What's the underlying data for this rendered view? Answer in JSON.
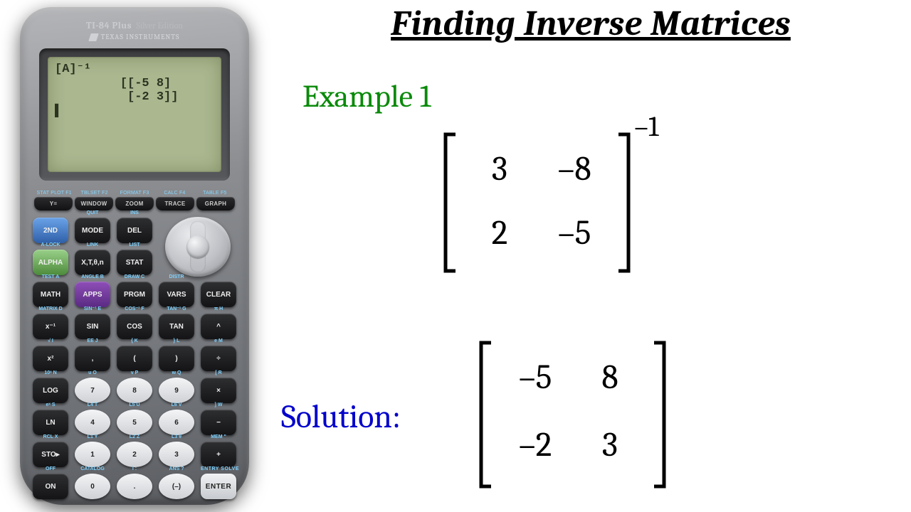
{
  "title": "Finding Inverse Matrices",
  "example_label": "Example 1",
  "solution_label": "Solution:",
  "matrix1": {
    "a11": "3",
    "a12": "–8",
    "a21": "2",
    "a22": "–5",
    "exp": "–1"
  },
  "matrix2": {
    "a11": "–5",
    "a12": "8",
    "a21": "–2",
    "a22": "3"
  },
  "calc": {
    "model": "TI-84 Plus",
    "edition": "Silver Edition",
    "brand": "TEXAS INSTRUMENTS",
    "screen": "[A]⁻¹\n         [[-5 8]\n          [-2 3]]\n▌",
    "frow_labels": [
      "STAT PLOT F1",
      "TBLSET F2",
      "FORMAT F3",
      "CALC F4",
      "TABLE F5"
    ],
    "frow_btns": [
      "Y=",
      "WINDOW",
      "ZOOM",
      "TRACE",
      "GRAPH"
    ],
    "rows": [
      [
        {
          "t": "2ND",
          "cls": "blue",
          "sup": ""
        },
        {
          "t": "MODE",
          "sup": "QUIT"
        },
        {
          "t": "DEL",
          "sup": "INS"
        },
        {
          "dpad": true
        }
      ],
      [
        {
          "t": "ALPHA",
          "cls": "green",
          "sup": "A-LOCK"
        },
        {
          "t": "X,T,θ,n",
          "sup": "LINK"
        },
        {
          "t": "STAT",
          "sup": "LIST"
        }
      ],
      [
        {
          "t": "MATH",
          "sup": "TEST A"
        },
        {
          "t": "APPS",
          "cls": "purple",
          "sup": "ANGLE B"
        },
        {
          "t": "PRGM",
          "sup": "DRAW C"
        },
        {
          "t": "VARS",
          "sup": "DISTR"
        },
        {
          "t": "CLEAR",
          "sup": ""
        }
      ],
      [
        {
          "t": "x⁻¹",
          "sup": "MATRIX D"
        },
        {
          "t": "SIN",
          "sup": "SIN⁻¹ E"
        },
        {
          "t": "COS",
          "sup": "COS⁻¹ F"
        },
        {
          "t": "TAN",
          "sup": "TAN⁻¹ G"
        },
        {
          "t": "^",
          "sup": "π H"
        }
      ],
      [
        {
          "t": "x²",
          "sup": "√  I"
        },
        {
          "t": ",",
          "sup": "EE J"
        },
        {
          "t": "(",
          "sup": "{ K"
        },
        {
          "t": ")",
          "sup": "} L"
        },
        {
          "t": "÷",
          "sup": "e M"
        }
      ],
      [
        {
          "t": "LOG",
          "sup": "10ˣ N"
        },
        {
          "t": "7",
          "cls": "white",
          "sup": "u O"
        },
        {
          "t": "8",
          "cls": "white",
          "sup": "v P"
        },
        {
          "t": "9",
          "cls": "white",
          "sup": "w Q"
        },
        {
          "t": "×",
          "sup": "[ R"
        }
      ],
      [
        {
          "t": "LN",
          "sup": "eˣ S"
        },
        {
          "t": "4",
          "cls": "white",
          "sup": "L4 T"
        },
        {
          "t": "5",
          "cls": "white",
          "sup": "L5 U"
        },
        {
          "t": "6",
          "cls": "white",
          "sup": "L6 V"
        },
        {
          "t": "−",
          "sup": "] W"
        }
      ],
      [
        {
          "t": "STO▸",
          "sup": "RCL X"
        },
        {
          "t": "1",
          "cls": "white",
          "sup": "L1 Y"
        },
        {
          "t": "2",
          "cls": "white",
          "sup": "L2 Z"
        },
        {
          "t": "3",
          "cls": "white",
          "sup": "L3 θ"
        },
        {
          "t": "+",
          "sup": "MEM \""
        }
      ],
      [
        {
          "t": "ON",
          "sup": "OFF"
        },
        {
          "t": "0",
          "cls": "white",
          "sup": "CATALOG"
        },
        {
          "t": ".",
          "cls": "white",
          "sup": "i  :"
        },
        {
          "t": "(–)",
          "cls": "white",
          "sup": "ANS ?"
        },
        {
          "t": "ENTER",
          "cls": "enter",
          "sup": "ENTRY SOLVE"
        }
      ]
    ]
  }
}
